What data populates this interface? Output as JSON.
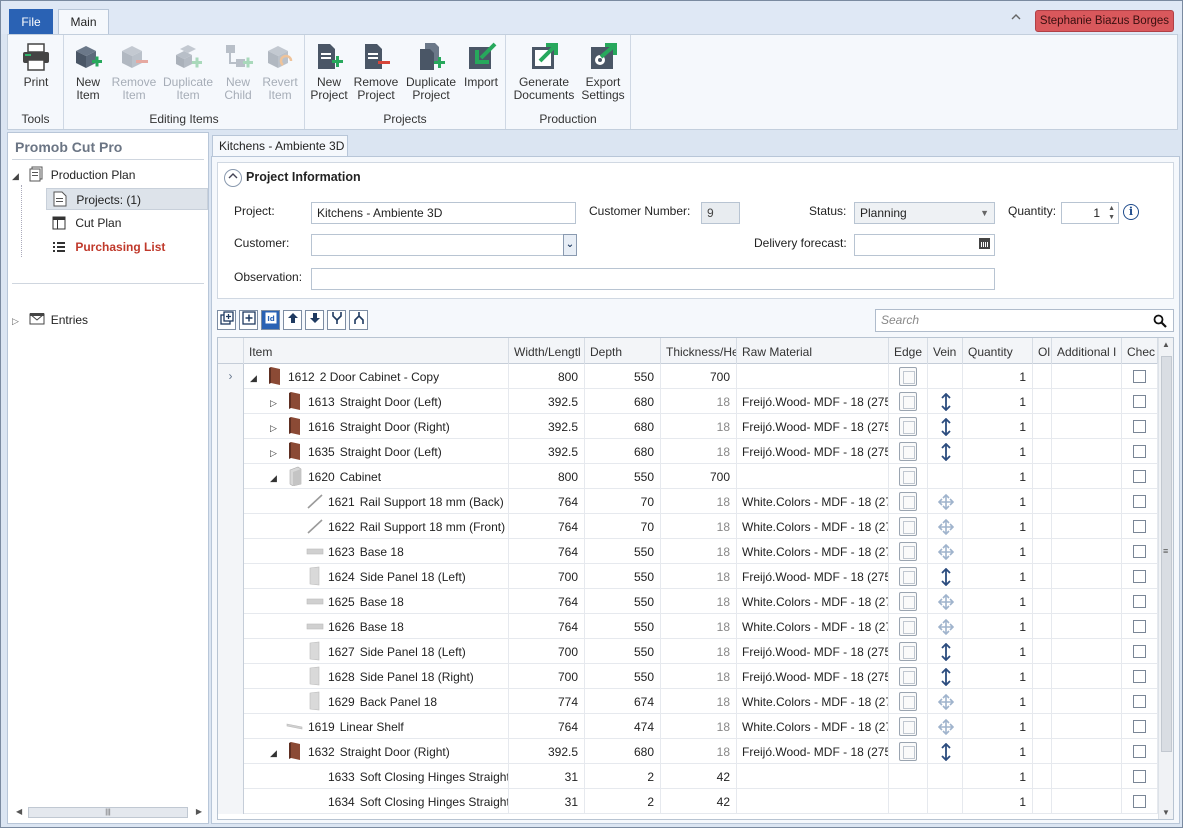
{
  "tabs": {
    "file": "File",
    "main": "Main"
  },
  "user": {
    "name": "Stephanie Biazus Borges"
  },
  "ribbon": {
    "groups": {
      "tools": "Tools",
      "editing": "Editing Items",
      "projects": "Projects",
      "production": "Production"
    },
    "buttons": {
      "print": [
        "Print",
        ""
      ],
      "new_item": [
        "New",
        "Item"
      ],
      "remove_item": [
        "Remove",
        "Item"
      ],
      "duplicate_item": [
        "Duplicate",
        "Item"
      ],
      "new_child": [
        "New",
        "Child"
      ],
      "revert_item": [
        "Revert",
        "Item"
      ],
      "new_project": [
        "New",
        "Project"
      ],
      "remove_project": [
        "Remove",
        "Project"
      ],
      "duplicate_project": [
        "Duplicate",
        "Project"
      ],
      "import": [
        "Import",
        ""
      ],
      "generate_documents": [
        "Generate",
        "Documents"
      ],
      "export_settings": [
        "Export",
        "Settings"
      ]
    }
  },
  "sidebar": {
    "title": "Promob Cut Pro",
    "production_plan": "Production Plan",
    "projects": "Projects: (1)",
    "cut_plan": "Cut Plan",
    "purchasing_list": "Purchasing List",
    "entries": "Entries"
  },
  "doc_tab": "Kitchens - Ambiente 3D",
  "project_info": {
    "title": "Project Information",
    "project_label": "Project:",
    "project_value": "Kitchens - Ambiente 3D",
    "customer_number_label": "Customer Number:",
    "customer_number_value": "9",
    "status_label": "Status:",
    "status_value": "Planning",
    "quantity_label": "Quantity:",
    "quantity_value": "1",
    "customer_label": "Customer:",
    "customer_value": "",
    "delivery_label": "Delivery forecast:",
    "delivery_value": "",
    "observation_label": "Observation:",
    "observation_value": ""
  },
  "search": {
    "placeholder": "Search"
  },
  "grid": {
    "columns": [
      "Item",
      "Width/Lengtl",
      "Depth",
      "Thickness/He",
      "Raw Material",
      "Edge",
      "Vein",
      "Quantity",
      "Ol",
      "Additional I",
      "Chec"
    ],
    "rows": [
      {
        "indent": 0,
        "expander": "open",
        "icon": "door",
        "id": "1612",
        "name": "2 Door Cabinet - Copy",
        "width": "800",
        "depth": "550",
        "thick": "700",
        "thick_muted": false,
        "material": "",
        "vein": "",
        "qty": "1",
        "current": true
      },
      {
        "indent": 1,
        "expander": "closed",
        "icon": "door",
        "id": "1613",
        "name": "Straight Door (Left)",
        "width": "392.5",
        "depth": "680",
        "thick": "18",
        "thick_muted": true,
        "material": "Freijó.Wood- MDF - 18 (275",
        "vein": "vertical",
        "qty": "1"
      },
      {
        "indent": 1,
        "expander": "closed",
        "icon": "door",
        "id": "1616",
        "name": "Straight Door (Right)",
        "width": "392.5",
        "depth": "680",
        "thick": "18",
        "thick_muted": true,
        "material": "Freijó.Wood- MDF - 18 (275",
        "vein": "vertical",
        "qty": "1"
      },
      {
        "indent": 1,
        "expander": "closed",
        "icon": "door",
        "id": "1635",
        "name": "Straight Door (Left)",
        "width": "392.5",
        "depth": "680",
        "thick": "18",
        "thick_muted": true,
        "material": "Freijó.Wood- MDF - 18 (275",
        "vein": "vertical",
        "qty": "1"
      },
      {
        "indent": 1,
        "expander": "open",
        "icon": "cabinet",
        "id": "1620",
        "name": "Cabinet",
        "width": "800",
        "depth": "550",
        "thick": "700",
        "thick_muted": false,
        "material": "",
        "vein": "",
        "qty": "1"
      },
      {
        "indent": 2,
        "expander": "",
        "icon": "rail",
        "id": "1621",
        "name": "Rail Support 18 mm (Back)",
        "width": "764",
        "depth": "70",
        "thick": "18",
        "thick_muted": true,
        "material": "White.Colors - MDF - 18 (27",
        "vein": "cross",
        "qty": "1"
      },
      {
        "indent": 2,
        "expander": "",
        "icon": "rail",
        "id": "1622",
        "name": "Rail Support 18 mm (Front)",
        "width": "764",
        "depth": "70",
        "thick": "18",
        "thick_muted": true,
        "material": "White.Colors - MDF - 18 (27",
        "vein": "cross",
        "qty": "1"
      },
      {
        "indent": 2,
        "expander": "",
        "icon": "base",
        "id": "1623",
        "name": "Base 18",
        "width": "764",
        "depth": "550",
        "thick": "18",
        "thick_muted": true,
        "material": "White.Colors - MDF - 18 (27",
        "vein": "cross",
        "qty": "1"
      },
      {
        "indent": 2,
        "expander": "",
        "icon": "panel",
        "id": "1624",
        "name": "Side Panel 18 (Left)",
        "width": "700",
        "depth": "550",
        "thick": "18",
        "thick_muted": true,
        "material": "Freijó.Wood- MDF - 18 (275",
        "vein": "vertical",
        "qty": "1"
      },
      {
        "indent": 2,
        "expander": "",
        "icon": "base",
        "id": "1625",
        "name": "Base 18",
        "width": "764",
        "depth": "550",
        "thick": "18",
        "thick_muted": true,
        "material": "White.Colors - MDF - 18 (27",
        "vein": "cross",
        "qty": "1"
      },
      {
        "indent": 2,
        "expander": "",
        "icon": "base",
        "id": "1626",
        "name": "Base 18",
        "width": "764",
        "depth": "550",
        "thick": "18",
        "thick_muted": true,
        "material": "White.Colors - MDF - 18 (27",
        "vein": "cross",
        "qty": "1"
      },
      {
        "indent": 2,
        "expander": "",
        "icon": "panel",
        "id": "1627",
        "name": "Side Panel 18 (Left)",
        "width": "700",
        "depth": "550",
        "thick": "18",
        "thick_muted": true,
        "material": "Freijó.Wood- MDF - 18 (275",
        "vein": "vertical",
        "qty": "1"
      },
      {
        "indent": 2,
        "expander": "",
        "icon": "panel",
        "id": "1628",
        "name": "Side Panel 18 (Right)",
        "width": "700",
        "depth": "550",
        "thick": "18",
        "thick_muted": true,
        "material": "Freijó.Wood- MDF - 18 (275",
        "vein": "vertical",
        "qty": "1"
      },
      {
        "indent": 2,
        "expander": "",
        "icon": "panel",
        "id": "1629",
        "name": "Back Panel 18",
        "width": "774",
        "depth": "674",
        "thick": "18",
        "thick_muted": true,
        "material": "White.Colors - MDF - 18 (27",
        "vein": "cross",
        "qty": "1"
      },
      {
        "indent": 1,
        "expander": "",
        "icon": "shelf",
        "id": "1619",
        "name": "Linear Shelf",
        "width": "764",
        "depth": "474",
        "thick": "18",
        "thick_muted": true,
        "material": "White.Colors - MDF - 18 (27",
        "vein": "cross",
        "qty": "1"
      },
      {
        "indent": 1,
        "expander": "open",
        "icon": "door",
        "id": "1632",
        "name": "Straight Door (Right)",
        "width": "392.5",
        "depth": "680",
        "thick": "18",
        "thick_muted": true,
        "material": "Freijó.Wood- MDF - 18 (275",
        "vein": "vertical",
        "qty": "1"
      },
      {
        "indent": 2,
        "expander": "",
        "icon": "",
        "id": "1633",
        "name": "Soft Closing Hinges Straight",
        "width": "31",
        "depth": "2",
        "thick": "42",
        "thick_muted": false,
        "material": "",
        "vein": "",
        "qty": "1",
        "no_edge": true
      },
      {
        "indent": 2,
        "expander": "",
        "icon": "",
        "id": "1634",
        "name": "Soft Closing Hinges Straight",
        "width": "31",
        "depth": "2",
        "thick": "42",
        "thick_muted": false,
        "material": "",
        "vein": "",
        "qty": "1",
        "no_edge": true
      }
    ]
  }
}
